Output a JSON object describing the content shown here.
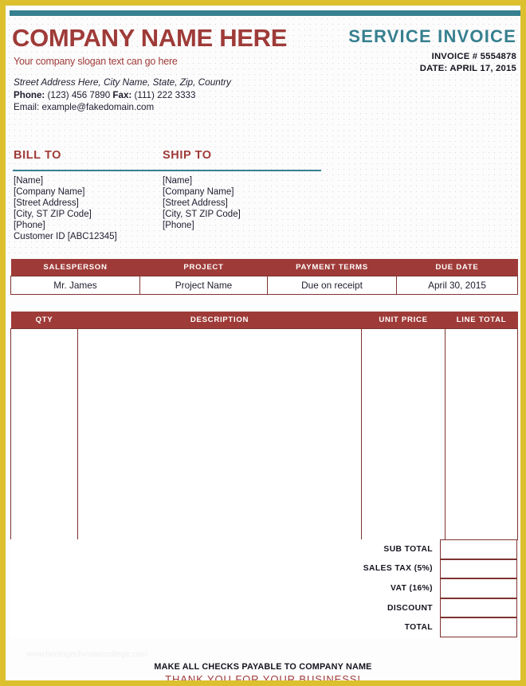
{
  "theme": {
    "frame_color": "#dcc02e",
    "accent_teal": "#37808f",
    "accent_red": "#9e3b38",
    "table_border": "#7e3330",
    "text_dark": "#1d1d2e",
    "page_background": "#fdfdfd"
  },
  "header": {
    "company_name": "COMPANY NAME HERE",
    "slogan": "Your company slogan text can go here",
    "address": "Street Address Here, City Name, State, Zip, Country",
    "phone_label": "Phone:",
    "phone_value": "(123) 456 7890",
    "fax_label": "Fax:",
    "fax_value": "(111) 222 3333",
    "email_label": "Email:",
    "email_value": "example@fakedomain.com",
    "doc_title": "SERVICE INVOICE",
    "invoice_number_line": "INVOICE # 5554878",
    "date_line": "DATE: APRIL 17, 2015"
  },
  "parties": {
    "bill_to": {
      "title": "BILL TO",
      "lines": [
        "[Name]",
        "[Company Name]",
        "[Street Address]",
        "[City, ST  ZIP Code]",
        "[Phone]",
        "Customer ID [ABC12345]"
      ]
    },
    "ship_to": {
      "title": "SHIP TO",
      "lines": [
        "[Name]",
        "[Company Name]",
        "[Street Address]",
        "[City, ST  ZIP Code]",
        "[Phone]"
      ]
    }
  },
  "info_table": {
    "headers": [
      "SALESPERSON",
      "PROJECT",
      "PAYMENT  TERMS",
      "DUE DATE"
    ],
    "row": [
      "Mr. James",
      "Project Name",
      "Due on receipt",
      "April 30, 2015"
    ]
  },
  "items_table": {
    "headers": [
      "QTY",
      "DESCRIPTION",
      "UNIT PRICE",
      "LINE TOTAL"
    ],
    "rows": []
  },
  "totals": [
    {
      "label": "SUB TOTAL",
      "value": ""
    },
    {
      "label": "SALES TAX  (5%)",
      "value": ""
    },
    {
      "label": "VAT (16%)",
      "value": ""
    },
    {
      "label": "DISCOUNT",
      "value": ""
    },
    {
      "label": "TOTAL",
      "value": ""
    }
  ],
  "footer": {
    "watermark": "www.heritagechristiancollege.com",
    "checks_note": "MAKE ALL CHECKS PAYABLE TO COMPANY NAME",
    "thank_you": "THANK YOU FOR YOUR BUSINESS!"
  }
}
